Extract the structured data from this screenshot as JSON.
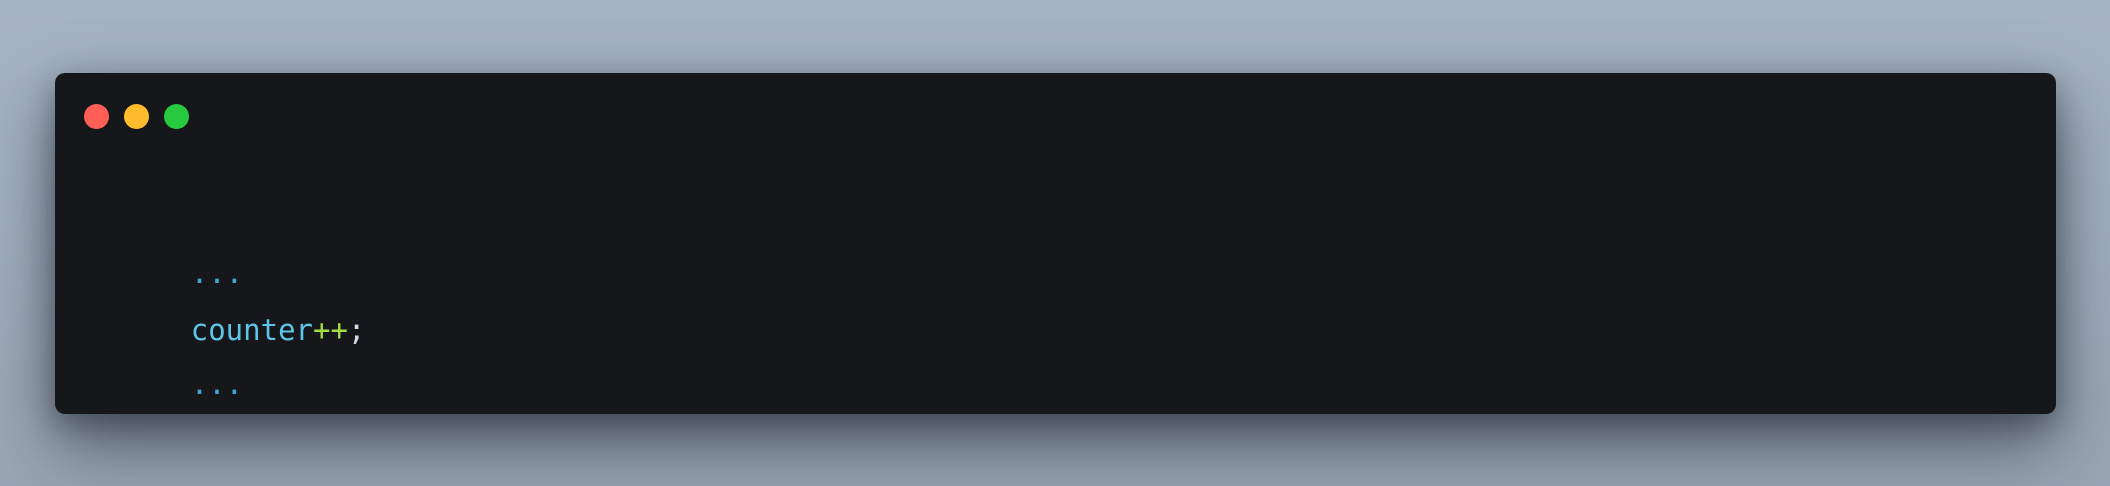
{
  "window": {
    "background": "#16171a",
    "controls": [
      {
        "name": "close",
        "color": "#ff5f56"
      },
      {
        "name": "minimize",
        "color": "#ffbd2e"
      },
      {
        "name": "maximize",
        "color": "#27c93f"
      }
    ]
  },
  "code": {
    "lines": [
      {
        "tokens": [
          {
            "text": "...",
            "kind": "ellipsis"
          }
        ]
      },
      {
        "tokens": [
          {
            "text": "counter",
            "kind": "ident"
          },
          {
            "text": "++",
            "kind": "op"
          },
          {
            "text": ";",
            "kind": "punct"
          }
        ]
      },
      {
        "tokens": [
          {
            "text": "...",
            "kind": "ellipsis"
          }
        ]
      }
    ],
    "colors": {
      "ellipsis": "#3fa6d6",
      "ident": "#5ec4e8",
      "op": "#a4de45",
      "punct": "#d7dadf"
    }
  }
}
